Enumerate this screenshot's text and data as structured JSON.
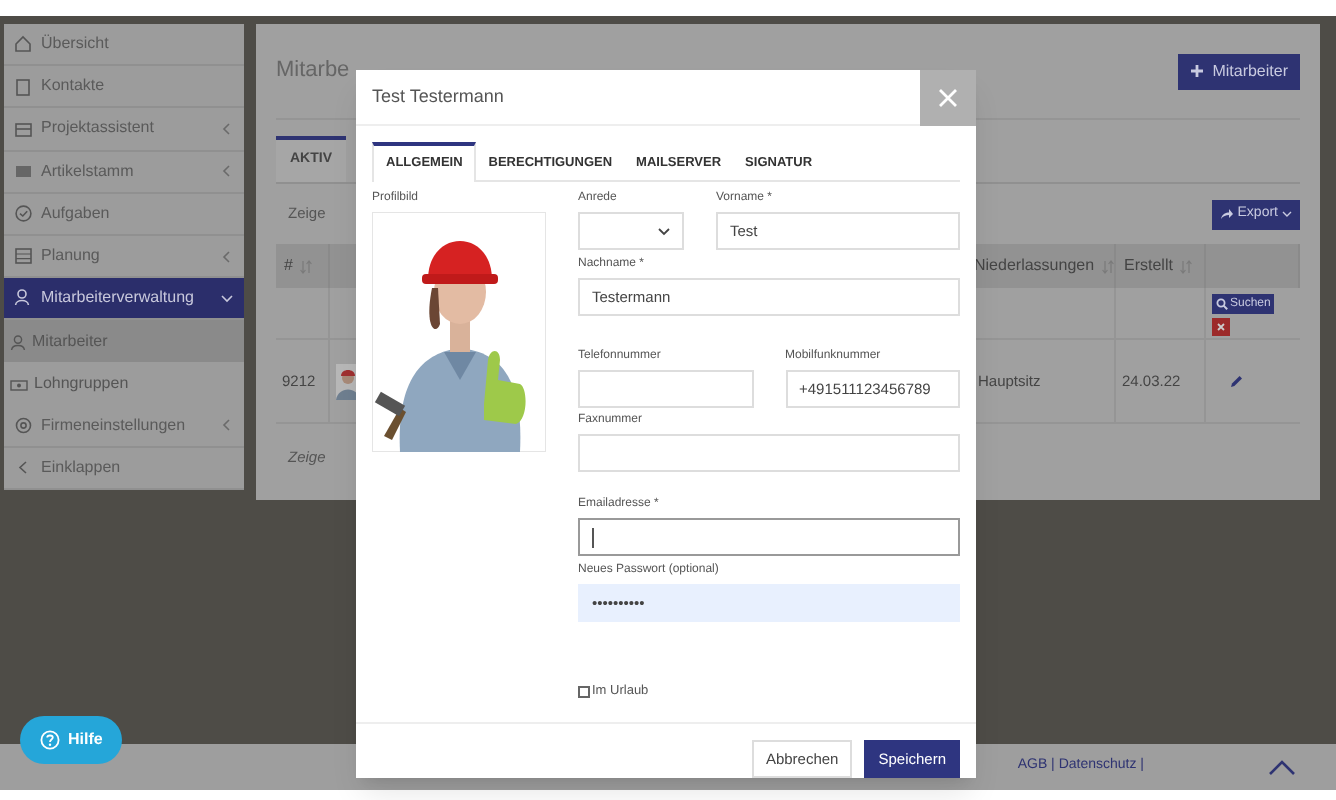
{
  "sidebar": {
    "items": [
      {
        "label": "Übersicht",
        "kind": "link",
        "selected": false
      },
      {
        "label": "Kontakte",
        "kind": "link",
        "selected": false
      },
      {
        "label": "Projektassistent",
        "kind": "group",
        "expanded": false,
        "selected": false
      },
      {
        "label": "Artikelstamm",
        "kind": "group",
        "expanded": false,
        "selected": false
      },
      {
        "label": "Aufgaben",
        "kind": "link",
        "selected": false
      },
      {
        "label": "Planung",
        "kind": "group",
        "expanded": false,
        "selected": false
      },
      {
        "label": "Mitarbeiterverwaltung",
        "kind": "group",
        "expanded": true,
        "selected": true,
        "children": [
          {
            "label": "Mitarbeiter",
            "selected": true
          },
          {
            "label": "Lohngruppen",
            "selected": false
          }
        ]
      },
      {
        "label": "Firmeneinstellungen",
        "kind": "group",
        "expanded": false,
        "selected": false
      },
      {
        "label": "Einklappen",
        "kind": "collapse",
        "selected": false
      }
    ]
  },
  "main": {
    "page_title": "Mitarbe",
    "add_button": "Mitarbeiter",
    "tabs": [
      {
        "label": "AKTIV",
        "selected": true
      }
    ],
    "show_label_top": "Zeige",
    "export_button": "Export",
    "table": {
      "columns": [
        "#",
        "Niederlassungen",
        "Erstellt"
      ],
      "search_button": "Suchen",
      "rows": [
        {
          "id": "9212",
          "branch": "Hauptsitz",
          "created": "24.03.22"
        }
      ]
    },
    "show_label_bottom": "Zeige"
  },
  "modal": {
    "title": "Test Testermann",
    "tabs": [
      {
        "label": "ALLGEMEIN",
        "selected": true
      },
      {
        "label": "BERECHTIGUNGEN",
        "selected": false
      },
      {
        "label": "MAILSERVER",
        "selected": false
      },
      {
        "label": "SIGNATUR",
        "selected": false
      }
    ],
    "profile_label": "Profilbild",
    "field_rows": [
      [
        {
          "kind": "select",
          "label": "Anrede"
        },
        {
          "kind": "text",
          "label": "Vorname *",
          "value": "Test",
          "focused": false
        }
      ],
      [
        {
          "kind": "text",
          "label": "Nachname *",
          "value": "Testermann",
          "focused": false
        }
      ],
      [
        {
          "kind": "text",
          "label": "Telefonnummer",
          "focused": false
        },
        {
          "kind": "text",
          "label": "Mobilfunknummer",
          "value": "+491511123456789",
          "focused": false
        }
      ],
      [
        {
          "kind": "text",
          "label": "Faxnummer",
          "focused": false
        }
      ],
      [
        {
          "kind": "text",
          "label": "Emailadresse *",
          "focused": true
        }
      ],
      [
        {
          "kind": "password",
          "label": "Neues Passwort (optional)",
          "value": "••••••••••",
          "focused": false
        }
      ]
    ],
    "vacation": {
      "label": "Im Urlaub",
      "checked": false
    },
    "buttons": [
      {
        "label": "Abbrechen",
        "kind": "secondary"
      },
      {
        "label": "Speichern",
        "kind": "primary"
      }
    ]
  },
  "footer": {
    "links": "AGB | Datenschutz |"
  },
  "help_button": "Hilfe"
}
